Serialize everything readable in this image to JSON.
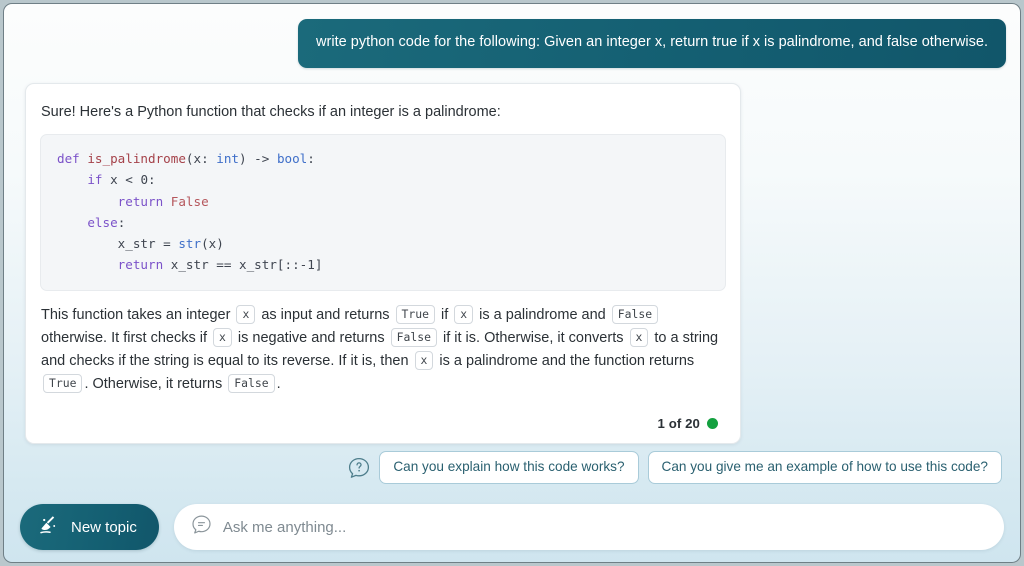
{
  "user_message": {
    "text": "write python code for the following: Given an integer x, return true if x is palindrome, and false otherwise."
  },
  "assistant_message": {
    "intro": "Sure! Here's a Python function that checks if an integer is a palindrome:",
    "code_tokens": [
      [
        {
          "t": "def ",
          "c": "kw"
        },
        {
          "t": "is_palindrome",
          "c": "fn"
        },
        {
          "t": "(x: ",
          "c": "plain"
        },
        {
          "t": "int",
          "c": "type"
        },
        {
          "t": ") -> ",
          "c": "plain"
        },
        {
          "t": "bool",
          "c": "type"
        },
        {
          "t": ":",
          "c": "plain"
        }
      ],
      [
        {
          "t": "    ",
          "c": "plain"
        },
        {
          "t": "if",
          "c": "kw"
        },
        {
          "t": " x < ",
          "c": "plain"
        },
        {
          "t": "0",
          "c": "num"
        },
        {
          "t": ":",
          "c": "plain"
        }
      ],
      [
        {
          "t": "        ",
          "c": "plain"
        },
        {
          "t": "return",
          "c": "kw"
        },
        {
          "t": " ",
          "c": "plain"
        },
        {
          "t": "False",
          "c": "bool"
        }
      ],
      [
        {
          "t": "    ",
          "c": "plain"
        },
        {
          "t": "else",
          "c": "kw"
        },
        {
          "t": ":",
          "c": "plain"
        }
      ],
      [
        {
          "t": "        x_str = ",
          "c": "plain"
        },
        {
          "t": "str",
          "c": "type"
        },
        {
          "t": "(x)",
          "c": "plain"
        }
      ],
      [
        {
          "t": "        ",
          "c": "plain"
        },
        {
          "t": "return",
          "c": "kw"
        },
        {
          "t": " x_str == x_str[::-",
          "c": "plain"
        },
        {
          "t": "1",
          "c": "num"
        },
        {
          "t": "]",
          "c": "plain"
        }
      ]
    ],
    "explanation_parts": [
      {
        "type": "text",
        "v": "This function takes an integer "
      },
      {
        "type": "chip",
        "v": "x"
      },
      {
        "type": "text",
        "v": " as input and returns "
      },
      {
        "type": "chip",
        "v": "True"
      },
      {
        "type": "text",
        "v": " if "
      },
      {
        "type": "chip",
        "v": "x"
      },
      {
        "type": "text",
        "v": " is a palindrome and "
      },
      {
        "type": "chip",
        "v": "False"
      },
      {
        "type": "text",
        "v": " otherwise. It first checks if "
      },
      {
        "type": "chip",
        "v": "x"
      },
      {
        "type": "text",
        "v": " is negative and returns "
      },
      {
        "type": "chip",
        "v": "False"
      },
      {
        "type": "text",
        "v": " if it is. Otherwise, it converts "
      },
      {
        "type": "chip",
        "v": "x"
      },
      {
        "type": "text",
        "v": " to a string and checks if the string is equal to its reverse. If it is, then "
      },
      {
        "type": "chip",
        "v": "x"
      },
      {
        "type": "text",
        "v": " is a palindrome and the function returns "
      },
      {
        "type": "chip",
        "v": "True"
      },
      {
        "type": "text",
        "v": ". Otherwise, it returns "
      },
      {
        "type": "chip",
        "v": "False"
      },
      {
        "type": "text",
        "v": "."
      }
    ],
    "page_counter": "1 of 20",
    "status_color": "#13a03f"
  },
  "suggestions": {
    "help_icon": "question-speech-bubble-icon",
    "items": [
      {
        "label": "Can you explain how this code works?"
      },
      {
        "label": "Can you give me an example of how to use this code?"
      }
    ]
  },
  "bottom_bar": {
    "new_topic_label": "New topic",
    "new_topic_icon": "broom-icon",
    "composer_icon": "chat-bubble-icon",
    "composer_placeholder": "Ask me anything...",
    "composer_value": ""
  },
  "theme": {
    "accent_teal": "#145f72",
    "suggestion_border": "#a9cbd9",
    "status_green": "#13a03f"
  }
}
